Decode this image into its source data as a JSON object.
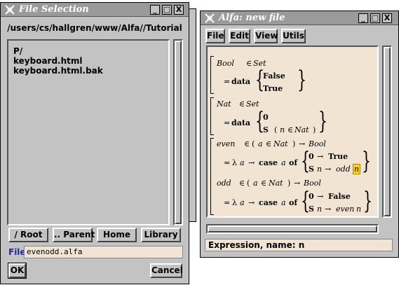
{
  "file_window": {
    "title": "File Selection",
    "path": "/users/cs/hallgren/www/Alfa//Tutorial",
    "files": [
      "P/",
      "keyboard.html",
      "keyboard.html.bak"
    ],
    "buttons": {
      "root": "/ Root",
      "parent": ".. Parent",
      "home": "Home",
      "library": "Library"
    },
    "file_label": "File",
    "file_value": "evenodd.alfa",
    "ok": "OK",
    "cancel": "Cancel",
    "title_buttons": [
      "_",
      "□",
      "X"
    ]
  },
  "alfa_window": {
    "title": "Alfa: new file",
    "menu": [
      "File",
      "Edit",
      "View",
      "Utils"
    ],
    "status": "Expression, name: n",
    "title_buttons": [
      "_",
      "□",
      "X"
    ],
    "doc": {
      "bool_decl": "Bool",
      "set": "Set",
      "elem": "∈",
      "eq": "=",
      "data_kw": "data",
      "false_c": "False",
      "true_c": "True",
      "nat_decl": "Nat",
      "zero": "0",
      "succ": "S",
      "n_var": "n",
      "even": "even",
      "odd": "odd",
      "a_var": "a",
      "lambda": "λ",
      "arrow": "→",
      "case_kw": "case",
      "of_kw": "of",
      "lparen": "(",
      "rparen": ")",
      "lbrace": "{",
      "rbrace": "}"
    }
  }
}
